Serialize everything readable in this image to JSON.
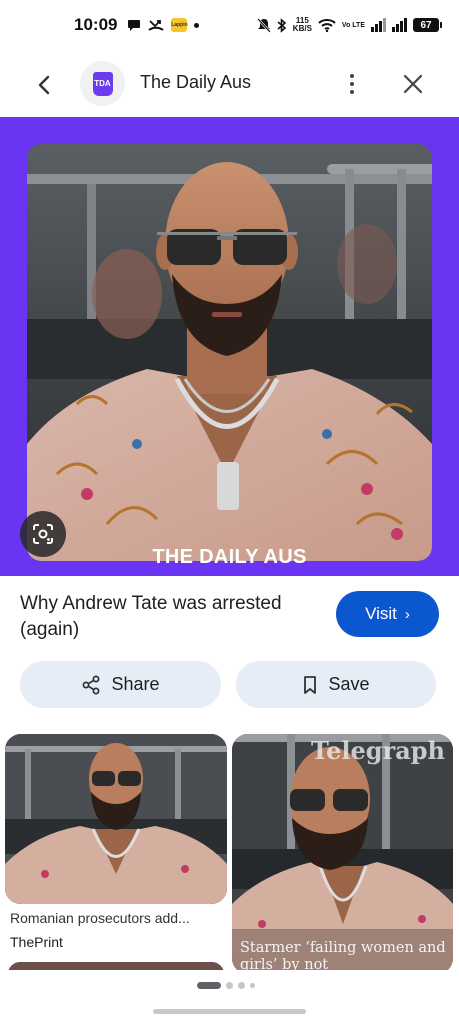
{
  "status_bar": {
    "time": "10:09",
    "net_speed_value": "115",
    "net_speed_unit": "KB/S",
    "volte": "Vo LTE",
    "battery": "67",
    "app_badge": "Lapplo"
  },
  "header": {
    "site_name": "The Daily Aus",
    "favicon_text": "TDA"
  },
  "hero": {
    "caption": "THE DAILY AUS",
    "brand_color": "#6a35f2"
  },
  "result": {
    "title": "Why Andrew Tate was arrested (again)",
    "visit_label": "Visit",
    "visit_chevron": "›"
  },
  "actions": {
    "share_label": "Share",
    "save_label": "Save"
  },
  "related": [
    {
      "title": "Romanian prosecutors add...",
      "source": "ThePrint"
    },
    {
      "watermark": "Telegraph",
      "overlay": "Starmer ‘failing women and girls’ by not"
    }
  ],
  "colors": {
    "accent": "#0b57d0",
    "action_bg": "#e6edf7"
  }
}
